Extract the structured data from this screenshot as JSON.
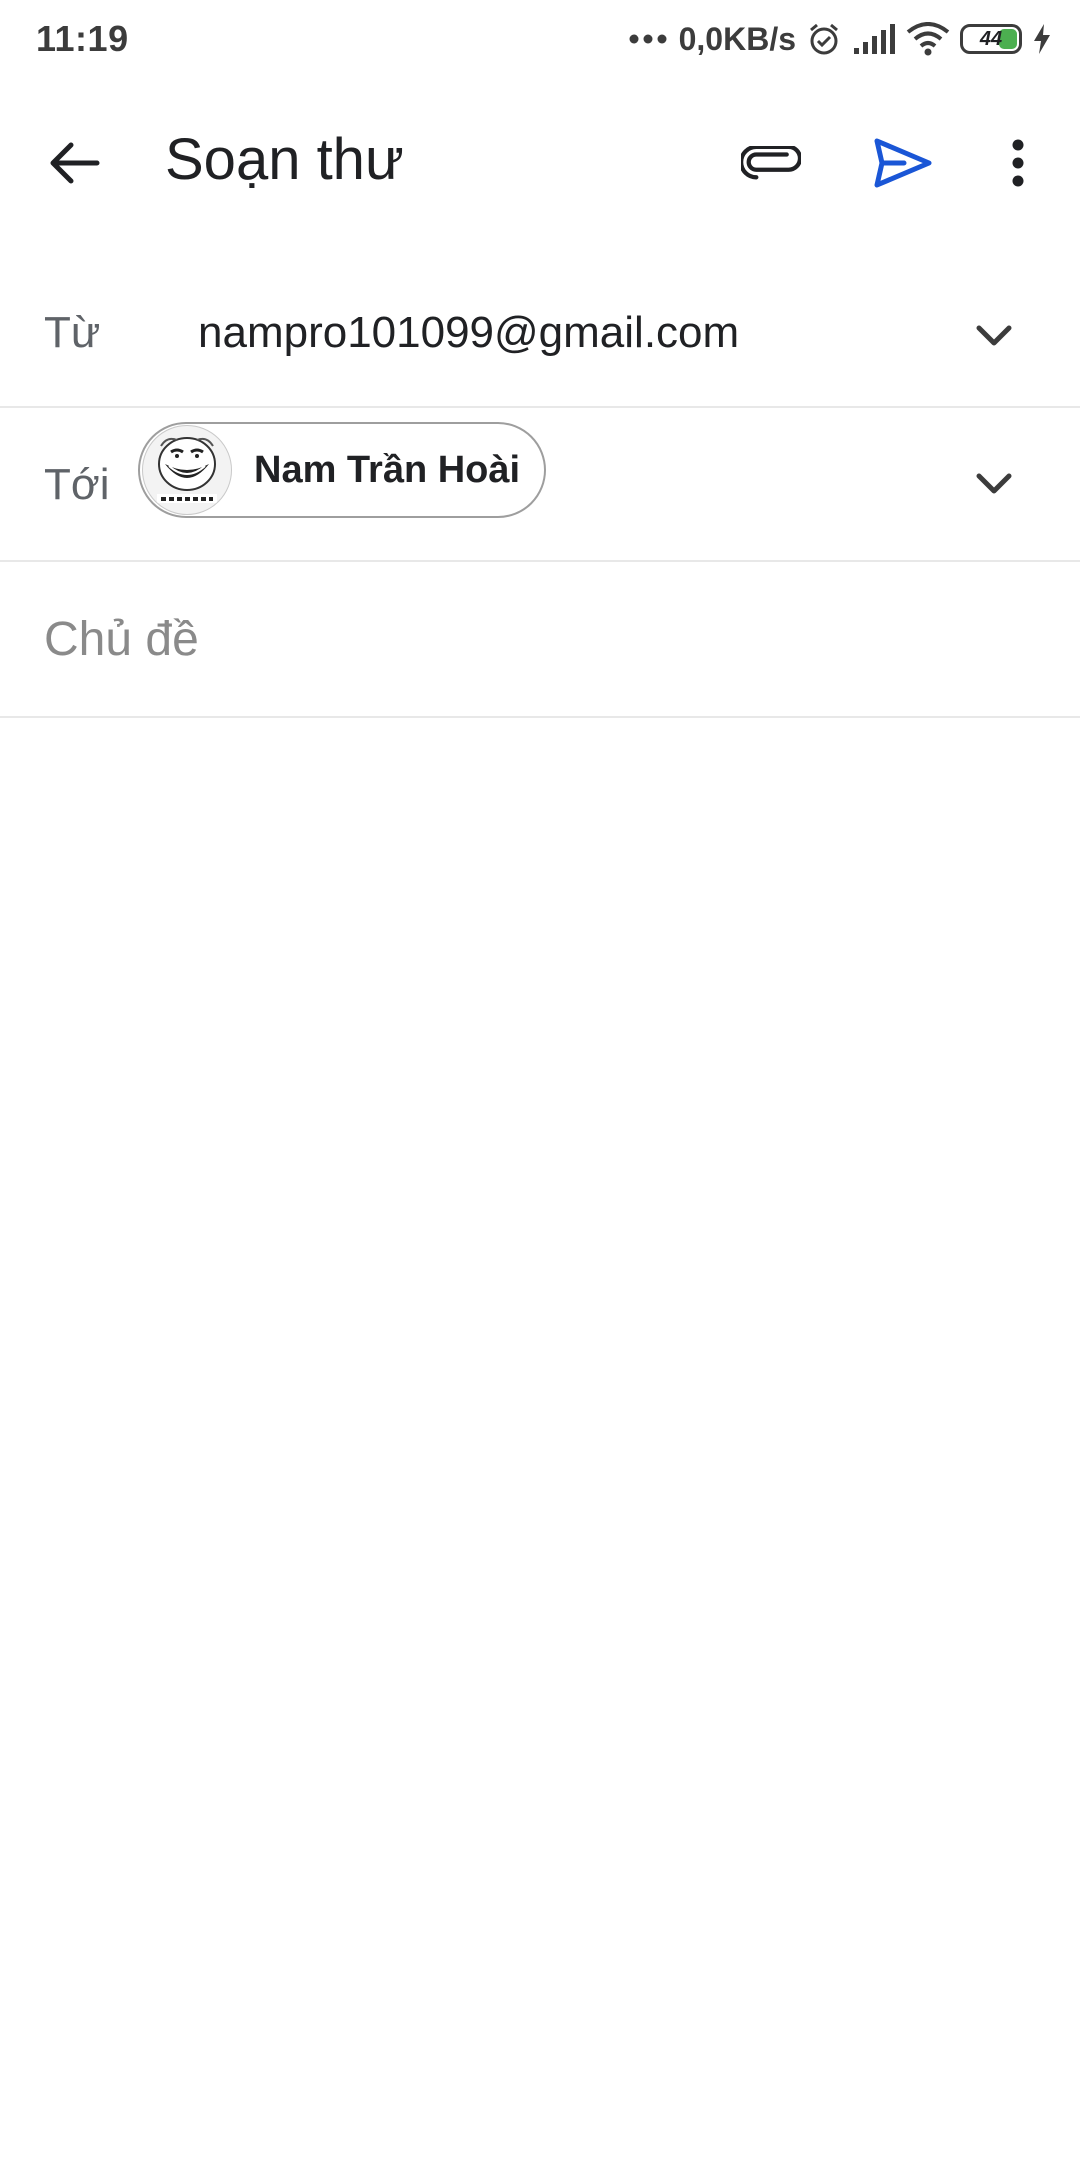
{
  "status_bar": {
    "time": "11:19",
    "network_speed": "0,0KB/s",
    "battery_level": "44",
    "icons": [
      "dots-icon",
      "alarm-icon",
      "signal-icon",
      "wifi-icon",
      "battery-icon",
      "charging-icon"
    ]
  },
  "app_bar": {
    "title": "Soạn thư",
    "back_icon": "arrow-back-icon",
    "attach_icon": "paperclip-icon",
    "send_icon": "send-icon",
    "more_icon": "more-vert-icon",
    "send_color": "#1a56d6"
  },
  "from_field": {
    "label": "Từ",
    "value": "nampro101099@gmail.com"
  },
  "to_field": {
    "label": "Tới",
    "recipient_name": "Nam Trần Hoài"
  },
  "subject_field": {
    "placeholder": "Chủ đề"
  }
}
